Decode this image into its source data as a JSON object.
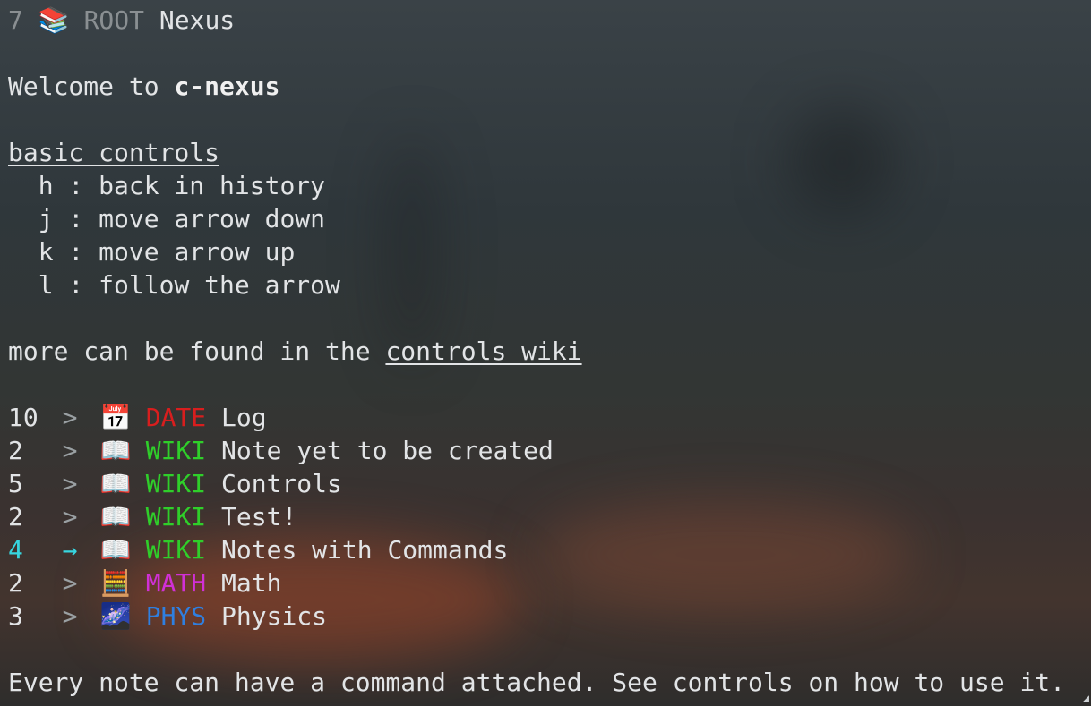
{
  "header": {
    "count": "7",
    "icon": "📚",
    "type": "ROOT",
    "title": "Nexus"
  },
  "welcome": {
    "prefix": "Welcome to ",
    "name": "c-nexus"
  },
  "controls": {
    "heading": "basic controls",
    "items": [
      {
        "key": "h",
        "desc": "back in history"
      },
      {
        "key": "j",
        "desc": "move arrow down"
      },
      {
        "key": "k",
        "desc": "move arrow up"
      },
      {
        "key": "l",
        "desc": "follow the arrow"
      }
    ]
  },
  "more": {
    "prefix": "more can be found in the ",
    "link": "controls wiki"
  },
  "links": [
    {
      "count": "10",
      "arrow": ">",
      "icon": "📅",
      "type": "DATE",
      "title": "Log",
      "kind": "date",
      "selected": false
    },
    {
      "count": "2",
      "arrow": ">",
      "icon": "📖",
      "type": "WIKI",
      "title": "Note yet to be created",
      "kind": "wiki",
      "selected": false
    },
    {
      "count": "5",
      "arrow": ">",
      "icon": "📖",
      "type": "WIKI",
      "title": "Controls",
      "kind": "wiki",
      "selected": false
    },
    {
      "count": "2",
      "arrow": ">",
      "icon": "📖",
      "type": "WIKI",
      "title": "Test!",
      "kind": "wiki",
      "selected": false
    },
    {
      "count": "4",
      "arrow": "→",
      "icon": "📖",
      "type": "WIKI",
      "title": "Notes with Commands",
      "kind": "wiki",
      "selected": true
    },
    {
      "count": "2",
      "arrow": ">",
      "icon": "🧮",
      "type": "MATH",
      "title": "Math",
      "kind": "math",
      "selected": false
    },
    {
      "count": "3",
      "arrow": ">",
      "icon": "🌌",
      "type": "PHYS",
      "title": "Physics",
      "kind": "phys",
      "selected": false
    }
  ],
  "footer": {
    "message": "Every note can have a command attached. See controls on how to use it."
  },
  "colors": {
    "date": "#d81e1e",
    "wiki": "#2fcf2a",
    "math": "#d130d6",
    "phys": "#2f7fe0",
    "selected": "#37d6e0"
  }
}
